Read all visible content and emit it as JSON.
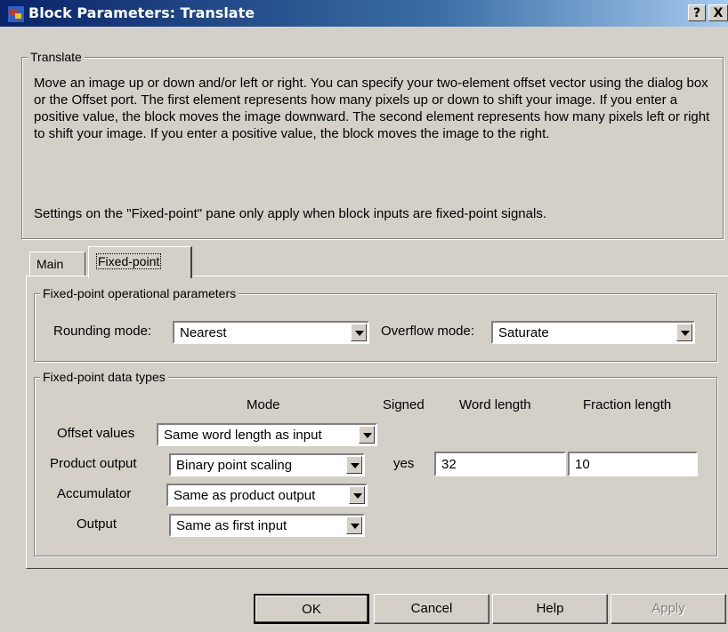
{
  "window": {
    "title": "Block Parameters: Translate",
    "help_label": "?",
    "close_label": "X"
  },
  "description_group": {
    "legend": "Translate",
    "text": "Move an image up or down and/or left or right. You can specify your two-element offset vector using the dialog box or the Offset port. The first element represents how many pixels up or down to shift your image. If you enter a positive value, the block moves the image downward.  The second element represents how many pixels left or right to shift your image. If you enter a positive value, the block moves the image to the right.",
    "note": "Settings on the \"Fixed-point\" pane only apply when block inputs are fixed-point signals."
  },
  "tabs": [
    {
      "label": "Main",
      "active": false
    },
    {
      "label": "Fixed-point",
      "active": true
    }
  ],
  "operational": {
    "legend": "Fixed-point operational parameters",
    "rounding_label": "Rounding mode:",
    "rounding_value": "Nearest",
    "overflow_label": "Overflow mode:",
    "overflow_value": "Saturate"
  },
  "datatypes": {
    "legend": "Fixed-point data types",
    "headers": {
      "mode": "Mode",
      "signed": "Signed",
      "word_length": "Word length",
      "fraction_length": "Fraction length"
    },
    "rows": [
      {
        "label": "Offset values",
        "mode": "Same word length as input"
      },
      {
        "label": "Product output",
        "mode": "Binary point scaling",
        "signed": "yes",
        "word_length": "32",
        "fraction_length": "10"
      },
      {
        "label": "Accumulator",
        "mode": "Same as product output"
      },
      {
        "label": "Output",
        "mode": "Same as first input"
      }
    ]
  },
  "buttons": {
    "ok": "OK",
    "cancel": "Cancel",
    "help": "Help",
    "apply": "Apply"
  }
}
